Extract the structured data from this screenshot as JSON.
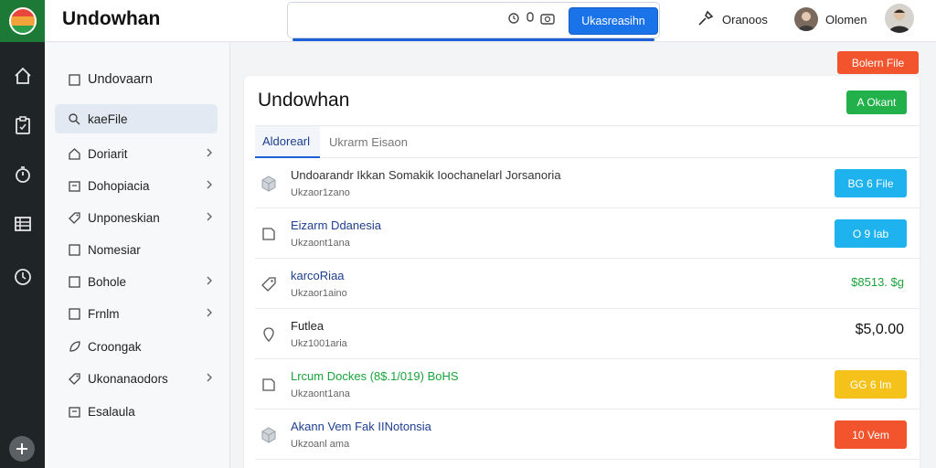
{
  "app": {
    "title": "Undowhan"
  },
  "search": {
    "placeholder": "",
    "button_label": "Ukasreasihn"
  },
  "topbar": {
    "action1_label": "Oranoos",
    "action2_label": "Olomen"
  },
  "sidebar": {
    "items": [
      {
        "label": "Undovaarn",
        "icon": "square-icon",
        "chevron": false,
        "active": false
      },
      {
        "label": "kaeFile",
        "icon": "search-icon",
        "chevron": false,
        "active": true
      },
      {
        "label": "Doriarit",
        "icon": "house-icon",
        "chevron": true,
        "active": false
      },
      {
        "label": "Dohopiacia",
        "icon": "box-icon",
        "chevron": true,
        "active": false
      },
      {
        "label": "Unponeskian",
        "icon": "tag-icon",
        "chevron": true,
        "active": false
      },
      {
        "label": "Nomesiar",
        "icon": "square-icon",
        "chevron": false,
        "active": false
      },
      {
        "label": "Bohole",
        "icon": "square-icon",
        "chevron": true,
        "active": false
      },
      {
        "label": "Frnlm",
        "icon": "square-icon",
        "chevron": true,
        "active": false
      },
      {
        "label": "Croongak",
        "icon": "leaf-icon",
        "chevron": false,
        "active": false
      },
      {
        "label": "Ukonanaodors",
        "icon": "tag-icon",
        "chevron": true,
        "active": false
      },
      {
        "label": "Esalaula",
        "icon": "box-icon",
        "chevron": false,
        "active": false
      }
    ]
  },
  "main": {
    "top_button_label": "Bolern File",
    "card_title": "Undowhan",
    "add_button_label": "A Okant",
    "tabs": [
      {
        "label": "Aldorearl"
      },
      {
        "label": "Ukrarm Eisaon"
      }
    ],
    "rows": [
      {
        "title": "Undoarandr Ikkan Somakik Ioochanelarl Jorsanoria",
        "sub": "Ukzaor1zano",
        "icon": "cube-icon",
        "action": {
          "kind": "button",
          "label": "BG 6 File",
          "color": "#1eb3ef"
        },
        "title_color": "#333333"
      },
      {
        "title": "Eizarm Ddanesia",
        "sub": "Ukzaont1ana",
        "icon": "box-icon",
        "action": {
          "kind": "button",
          "label": "O 9 Iab",
          "color": "#1eb3ef"
        },
        "title_color": "#1d3f8f"
      },
      {
        "title": "karcoRiaa",
        "sub": "Ukzaor1aino",
        "icon": "tag-icon",
        "action": {
          "kind": "amount",
          "label": "$8513. $g",
          "color": "#19a33c"
        },
        "title_color": "#1d3f8f"
      },
      {
        "title": "Futlea",
        "sub": "Ukz1001aria",
        "icon": "pin-icon",
        "action": {
          "kind": "amount",
          "label": "$5,0.00",
          "color": "#111111"
        },
        "title_color": "#222222"
      },
      {
        "title": "Lrcum Dockes (8$.1/019) BoHS",
        "sub": "Ukzaont1ana",
        "icon": "box-icon",
        "action": {
          "kind": "button",
          "label": "GG 6 Im",
          "color": "#f5c21b"
        },
        "title_color": "#19a33c"
      },
      {
        "title": "Akann Vem Fak IINotonsia",
        "sub": "Ukzoanl ama",
        "icon": "cube-icon",
        "action": {
          "kind": "button",
          "label": "10 Vem",
          "color": "#f2542d"
        },
        "title_color": "#1d3f8f"
      }
    ]
  }
}
